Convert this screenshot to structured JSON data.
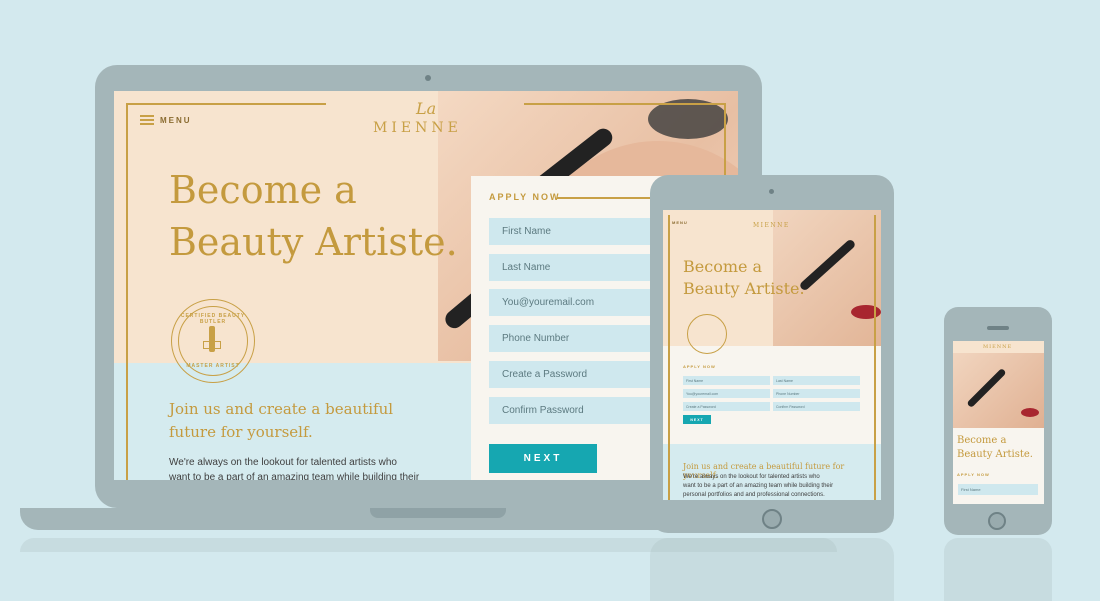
{
  "brand": {
    "la": "La",
    "name": "MIENNE"
  },
  "menu": {
    "label": "MENU"
  },
  "hero": {
    "line1": "Become a",
    "line2": "Beauty Artiste."
  },
  "badge": {
    "top": "CERTIFIED BEAUTY BUTLER",
    "bottom": "MASTER ARTIST"
  },
  "form": {
    "heading": "APPLY NOW",
    "fields": [
      {
        "placeholder": "First Name"
      },
      {
        "placeholder": "Last Name"
      },
      {
        "placeholder": "You@youremail.com"
      },
      {
        "placeholder": "Phone Number"
      },
      {
        "placeholder": "Create a Password"
      },
      {
        "placeholder": "Confirm Password"
      }
    ],
    "next_label": "NEXT"
  },
  "join": {
    "headline_line1": "Join us and create a beautiful",
    "headline_line2": "future for yourself.",
    "headline_single": "Join us and create a beautiful future for yourself.",
    "body_line1": "We're always on the lookout for talented artists who",
    "body_line2": "want to be a part of an amazing team while building their",
    "body_line3": "personal portfolios and and professional connections."
  },
  "colors": {
    "gold": "#c49a3e",
    "teal": "#16a7b1",
    "cream": "#f7e4cf",
    "sky": "#d3e9ee",
    "device": "#a4b6b9"
  }
}
